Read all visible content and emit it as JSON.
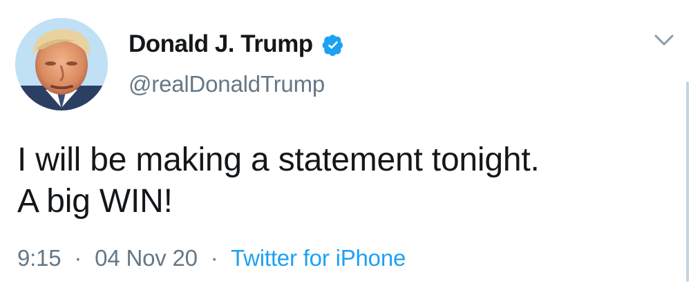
{
  "tweet": {
    "author": {
      "display_name": "Donald J. Trump",
      "handle": "@realDonaldTrump",
      "verified": true,
      "verified_color": "#1da1f2"
    },
    "text": "I will be making a statement tonight.\nA big WIN!",
    "time": "9:15",
    "date": "04 Nov 20",
    "separator": "·",
    "source": "Twitter for iPhone",
    "menu_icon": "chevron-down-icon",
    "avatar_icon": "avatar"
  },
  "colors": {
    "text_primary": "#14171a",
    "text_secondary": "#657786",
    "link": "#1da1f2"
  }
}
